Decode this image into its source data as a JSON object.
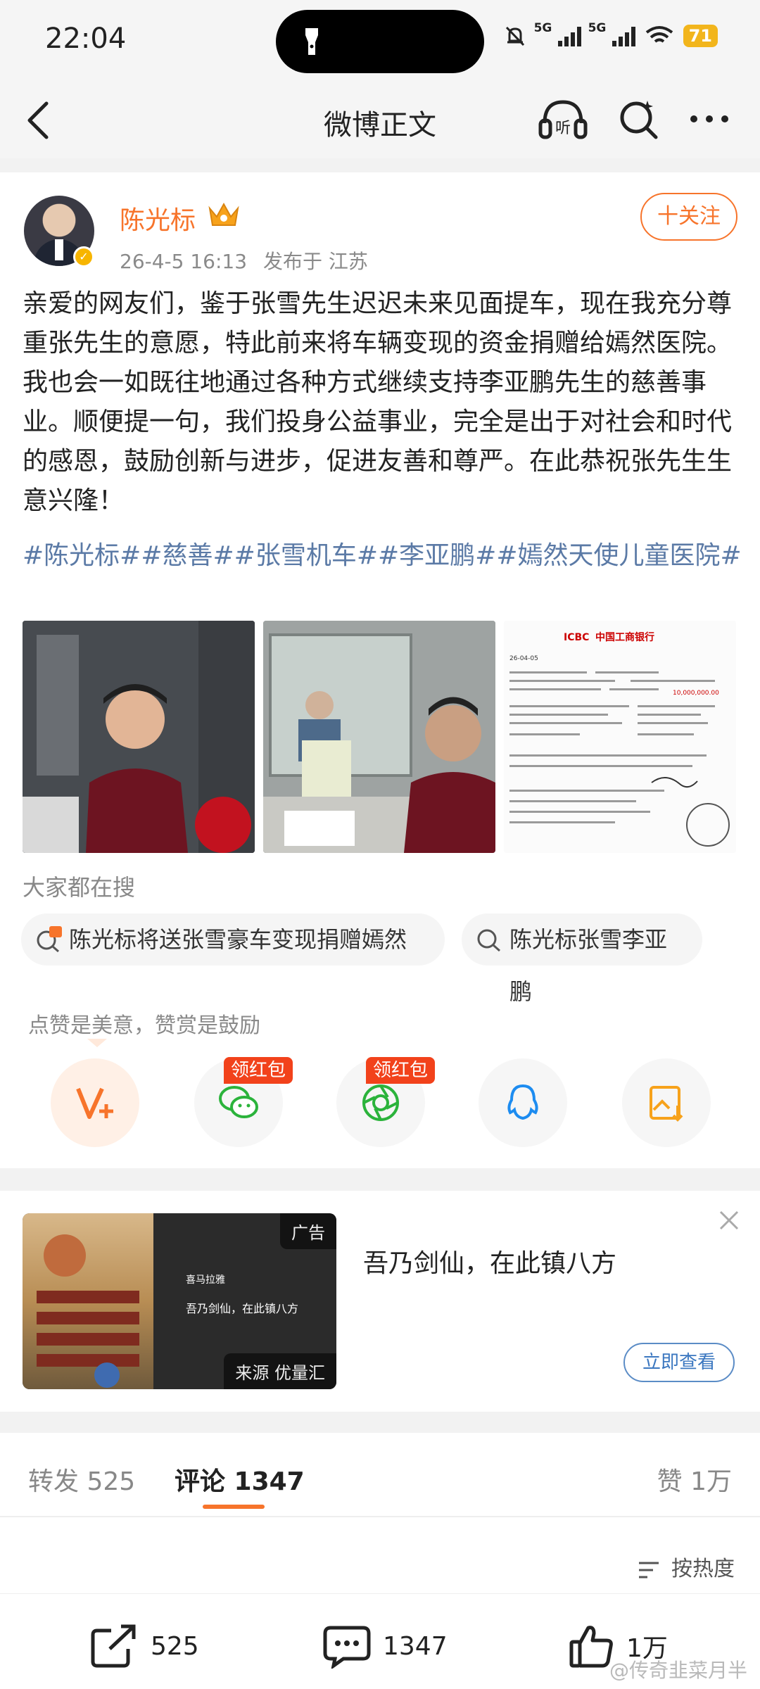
{
  "status_bar": {
    "time": "22:04",
    "network1": "5G",
    "network2": "5G",
    "battery": "71"
  },
  "header": {
    "title": "微博正文"
  },
  "post": {
    "author": "陈光标",
    "timestamp": "26-4-5 16:13",
    "location": "发布于 江苏",
    "follow_label": "十关注",
    "text": "亲爱的网友们，鉴于张雪先生迟迟未来见面提车，现在我充分尊重张先生的意愿，特此前来将车辆变现的资金捐赠给嫣然医院。我也会一如既往地通过各种方式继续支持李亚鹏先生的慈善事业。顺便提一句，我们投身公益事业，完全是出于对社会和时代的感恩，鼓励创新与进步，促进友善和尊严。在此恭祝张先生生意兴隆！",
    "tags": "#陈光标##慈善##张雪机车##李亚鹏##嫣然天使儿童医院#",
    "receipt": {
      "bank": "中国工商银行",
      "bank_code": "ICBC",
      "date": "26-04-05",
      "amount": "10,000,000.00"
    }
  },
  "search_section": {
    "title": "大家都在搜",
    "chips": [
      "陈光标将送张雪豪车变现捐赠嫣然",
      "陈光标张雪李亚鹏"
    ]
  },
  "reward": {
    "tip": "点赞是美意，赞赏是鼓励",
    "badge1": "领红包",
    "badge2": "领红包"
  },
  "ad": {
    "badge": "广告",
    "source": "来源 优量汇",
    "title": "吾乃剑仙，在此镇八方",
    "button": "立即查看",
    "brand": "喜马拉雅",
    "inner_text": "吾乃剑仙，在此镇八方"
  },
  "tabs": {
    "repost": "转发 525",
    "comment": "评论 1347",
    "like": "赞 1万",
    "sort": "按热度"
  },
  "bottom_bar": {
    "repost": "525",
    "comment": "1347",
    "like": "1万"
  },
  "watermark": "@传奇韭菜月半"
}
